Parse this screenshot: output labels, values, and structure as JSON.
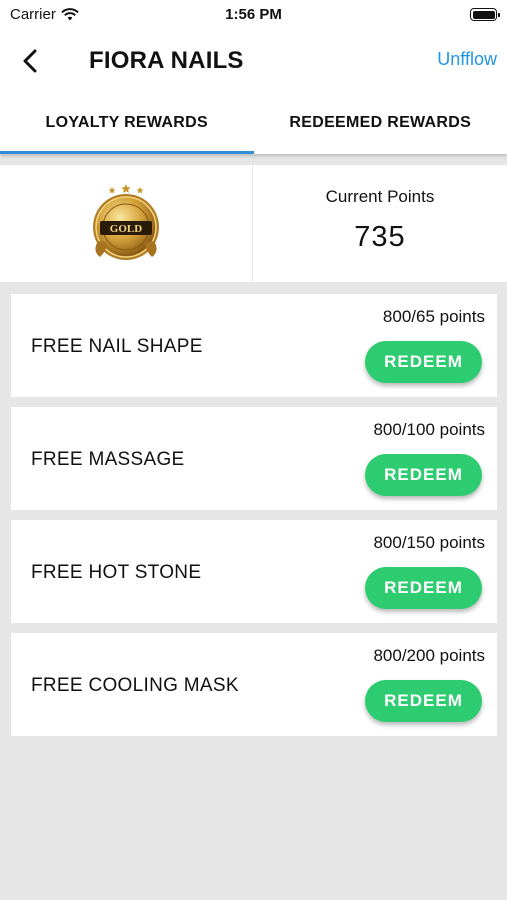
{
  "status_bar": {
    "carrier": "Carrier",
    "time": "1:56 PM"
  },
  "nav": {
    "title": "FIORA NAILS",
    "unfollow_label": "Unfflow"
  },
  "tabs": [
    {
      "label": "LOYALTY REWARDS",
      "active": true
    },
    {
      "label": "REDEEMED REWARDS",
      "active": false
    }
  ],
  "points": {
    "badge_text": "GOLD",
    "label": "Current Points",
    "value": "735"
  },
  "rewards": [
    {
      "name": "FREE NAIL SHAPE",
      "points": "800/65 points",
      "button_label": "REDEEM"
    },
    {
      "name": "FREE MASSAGE",
      "points": "800/100 points",
      "button_label": "REDEEM"
    },
    {
      "name": "FREE HOT STONE",
      "points": "800/150 points",
      "button_label": "REDEEM"
    },
    {
      "name": "FREE COOLING MASK",
      "points": "800/200 points",
      "button_label": "REDEEM"
    }
  ],
  "colors": {
    "accent": "#2196e3",
    "redeem": "#2ecc71",
    "tab_indicator": "#2f8fd6",
    "badge_gold": "#c9962e"
  }
}
